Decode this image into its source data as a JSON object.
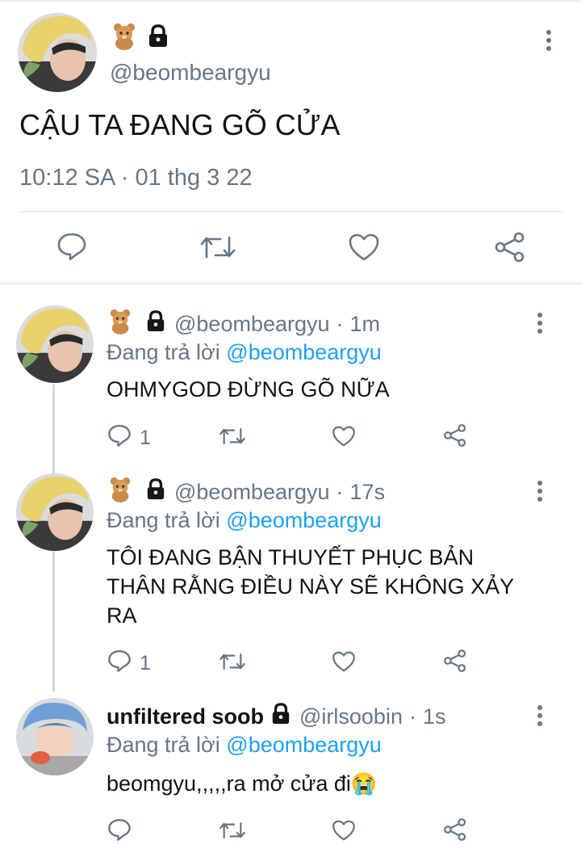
{
  "main_tweet": {
    "handle": "@beombeargyu",
    "text": "CẬU TA ĐANG GÕ CỬA",
    "timestamp": "10:12 SA · 01 thg 3 22",
    "badges": [
      "bear-emoji",
      "lock-icon"
    ]
  },
  "replies": [
    {
      "handle": "@beombeargyu",
      "time_sep": "·",
      "time": "1m",
      "replying_label": "Đang trả lời",
      "replying_to": "@beombeargyu",
      "text": "OHMYGOD ĐỪNG GÕ NỮA",
      "reply_count": "1"
    },
    {
      "handle": "@beombeargyu",
      "time_sep": "·",
      "time": "17s",
      "replying_label": "Đang trả lời",
      "replying_to": "@beombeargyu",
      "text_line1": "TÔI ĐANG BẬN THUYẾT PHỤC BẢN",
      "text_line2": "THÂN RẰNG ĐIỀU NÀY SẼ KHÔNG XẢY",
      "text_line3": "RA",
      "reply_count": "1"
    },
    {
      "display_name": "unfiltered soob",
      "handle": "@irlsoobin",
      "time_sep": "·",
      "time": "1s",
      "replying_label": "Đang trả lời",
      "replying_to": "@beombeargyu",
      "text": "beomgyu,,,,,ra mở cửa đi",
      "emoji": "😭"
    }
  ],
  "colors": {
    "link": "#1da1f2",
    "muted": "#657786",
    "divider": "#e6ecf0"
  }
}
